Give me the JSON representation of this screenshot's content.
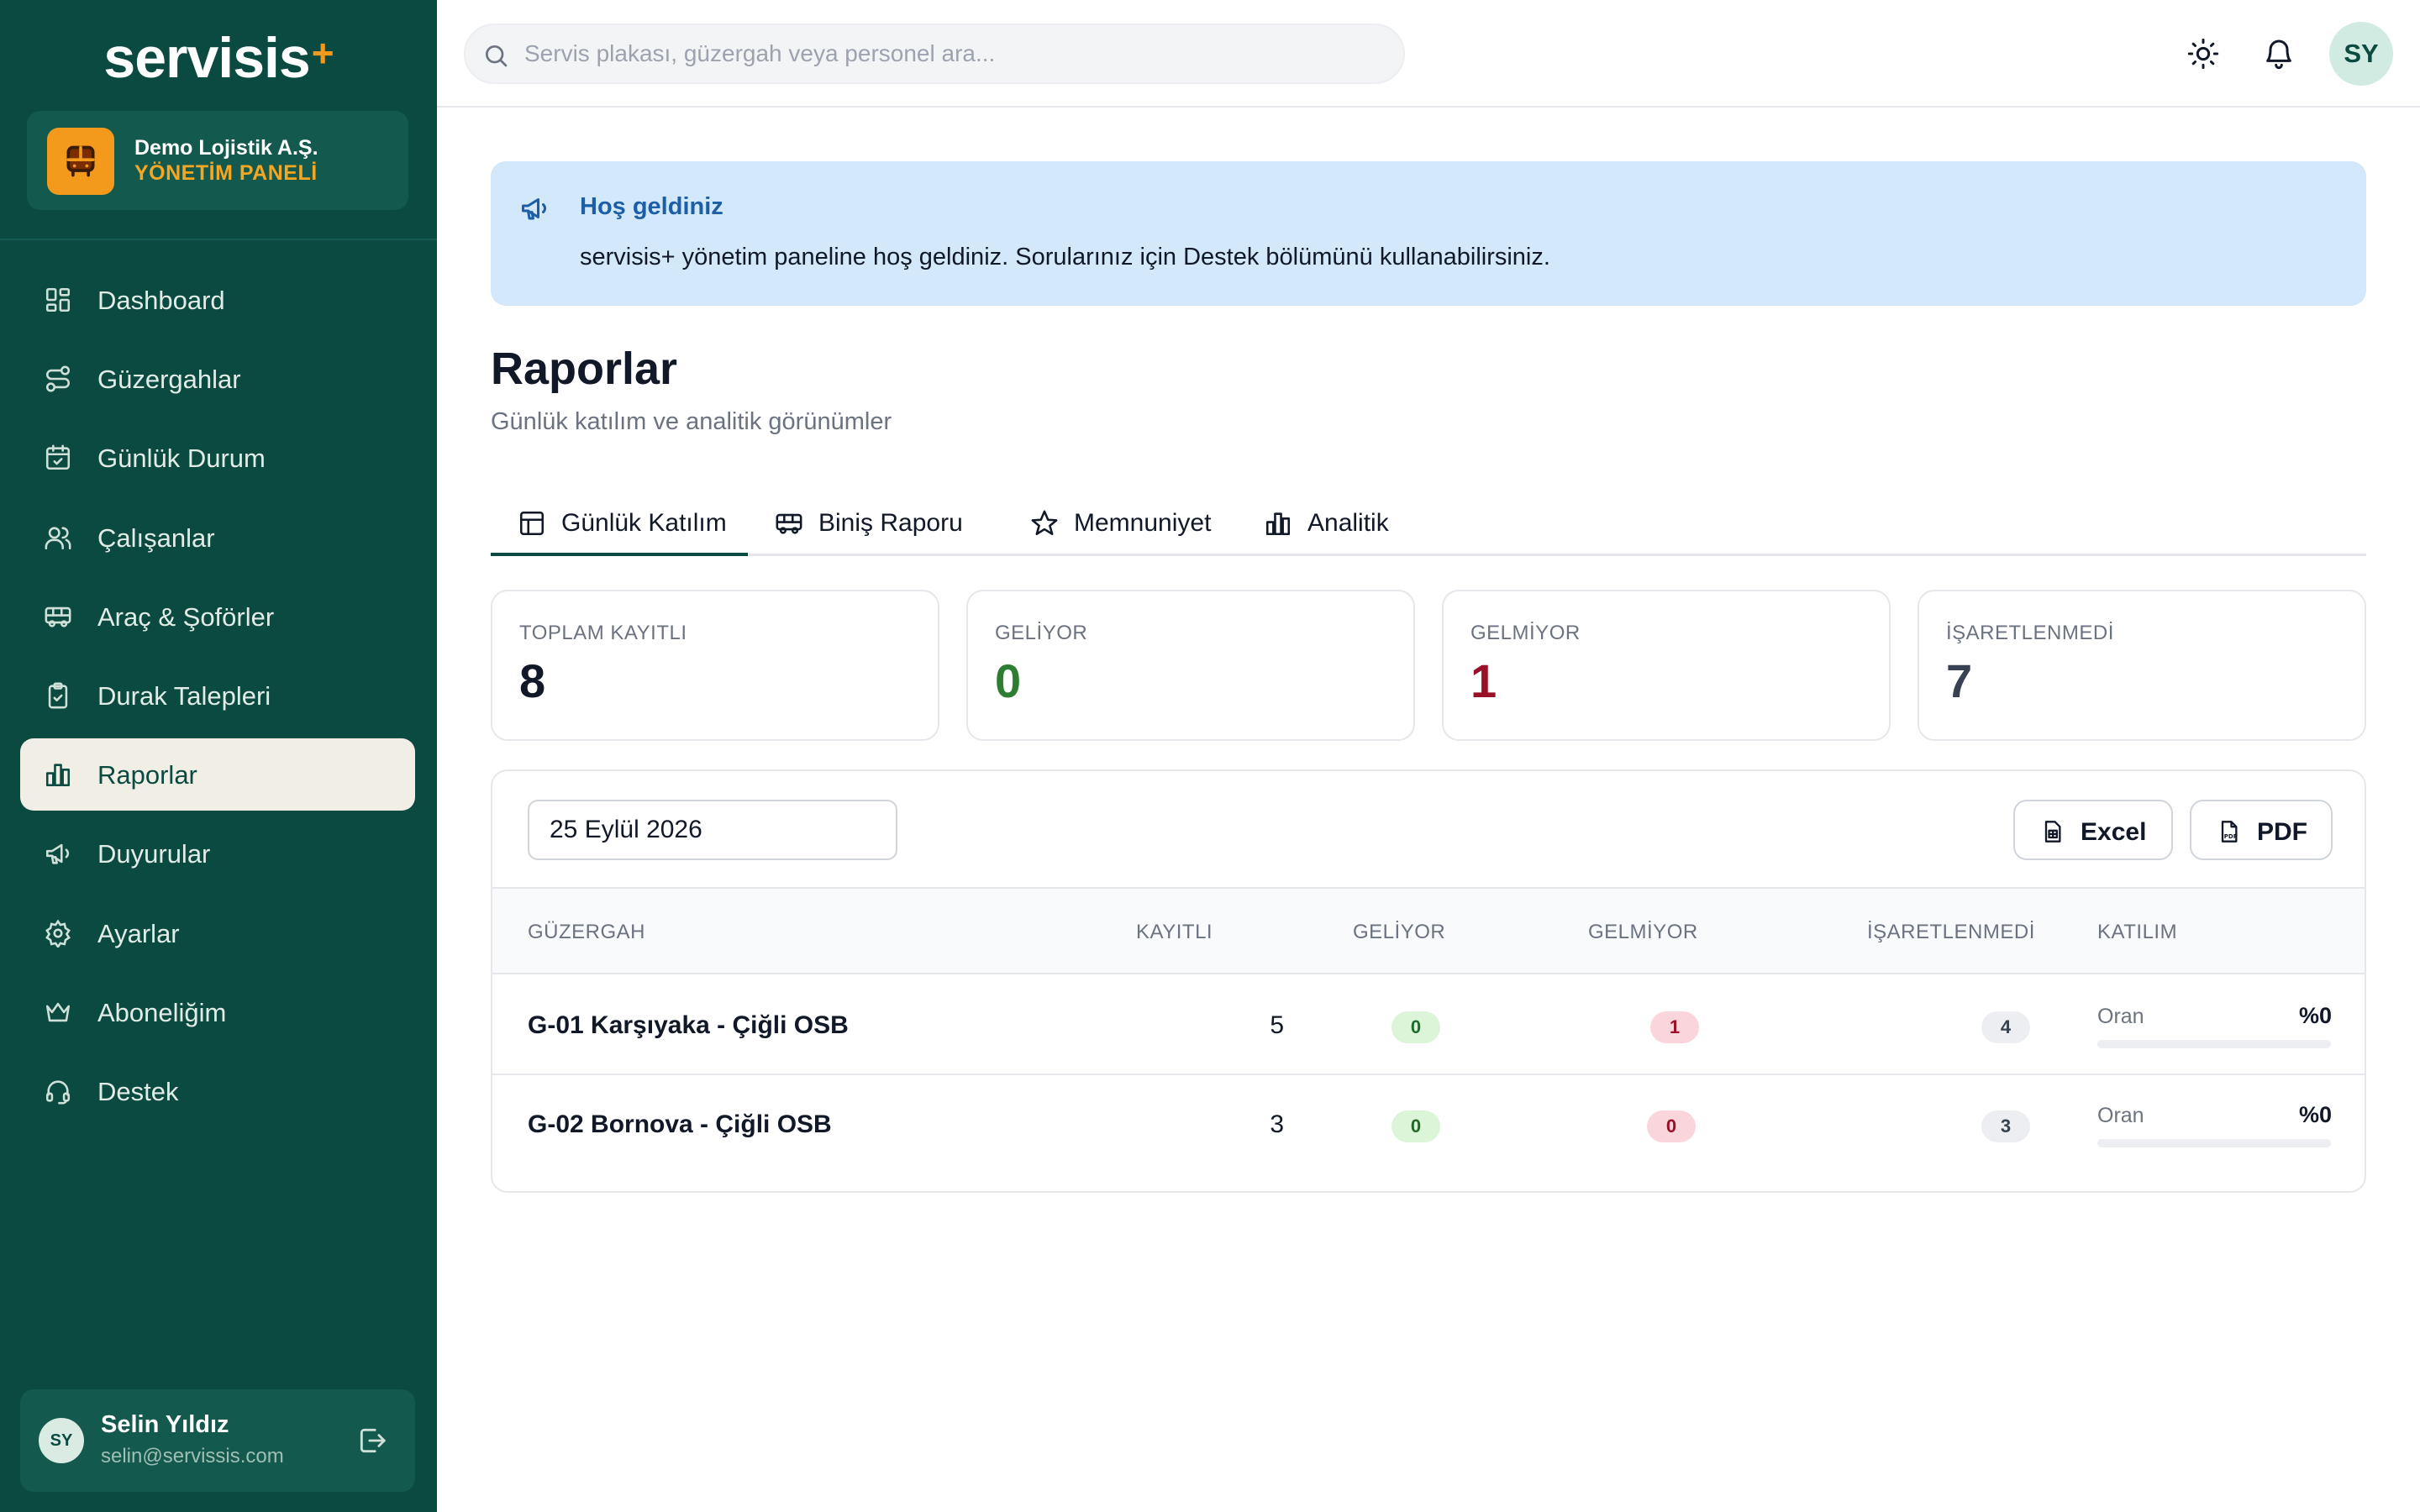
{
  "sidebar": {
    "logo_text": "servisis",
    "logo_plus": "+",
    "org": {
      "name": "Demo Lojistik A.Ş.",
      "role": "YÖNETİM PANELİ"
    },
    "items": [
      {
        "label": "Dashboard",
        "icon": "grid-icon"
      },
      {
        "label": "Güzergahlar",
        "icon": "route-icon"
      },
      {
        "label": "Günlük Durum",
        "icon": "calendar-check-icon"
      },
      {
        "label": "Çalışanlar",
        "icon": "users-icon"
      },
      {
        "label": "Araç & Şoförler",
        "icon": "bus-icon"
      },
      {
        "label": "Durak Talepleri",
        "icon": "clipboard-check-icon"
      },
      {
        "label": "Raporlar",
        "icon": "bar-chart-icon",
        "active": true
      },
      {
        "label": "Duyurular",
        "icon": "megaphone-icon"
      },
      {
        "label": "Ayarlar",
        "icon": "gear-icon"
      },
      {
        "label": "Aboneliğim",
        "icon": "crown-icon"
      },
      {
        "label": "Destek",
        "icon": "headset-icon"
      }
    ],
    "user": {
      "initials": "SY",
      "name": "Selin Yıldız",
      "email": "selin@servissis.com"
    }
  },
  "topbar": {
    "search_placeholder": "Servis plakası, güzergah veya personel ara...",
    "avatar_initials": "SY"
  },
  "banner": {
    "title": "Hoş geldiniz",
    "text": "servisis+ yönetim paneline hoş geldiniz. Sorularınız için Destek bölümünü kullanabilirsiniz."
  },
  "page": {
    "title": "Raporlar",
    "subtitle": "Günlük katılım ve analitik görünümler"
  },
  "tabs": [
    {
      "label": "Günlük Katılım",
      "icon": "table-icon",
      "active": true
    },
    {
      "label": "Biniş Raporu",
      "icon": "bus-icon"
    },
    {
      "label": "Memnuniyet",
      "icon": "star-icon"
    },
    {
      "label": "Analitik",
      "icon": "bar-chart-icon"
    }
  ],
  "stats": [
    {
      "label": "TOPLAM KAYITLI",
      "value": "8",
      "color": "#111827"
    },
    {
      "label": "GELİYOR",
      "value": "0",
      "color": "#2e7d32"
    },
    {
      "label": "GELMİYOR",
      "value": "1",
      "color": "#9b1029"
    },
    {
      "label": "İŞARETLENMEDİ",
      "value": "7",
      "color": "#374151"
    }
  ],
  "report": {
    "date_value": "25 Eylül 2026",
    "excel_label": "Excel",
    "pdf_label": "PDF",
    "columns": [
      "GÜZERGAH",
      "KAYITLI",
      "GELİYOR",
      "GELMİYOR",
      "İŞARETLENMEDİ",
      "KATILIM"
    ],
    "rows": [
      {
        "route": "G-01 Karşıyaka - Çiğli OSB",
        "registered": "5",
        "coming": "0",
        "not_coming": "1",
        "unmarked": "4",
        "rate_label": "Oran",
        "rate_value": "%0",
        "rate_fraction": 0
      },
      {
        "route": "G-02 Bornova - Çiğli OSB",
        "registered": "3",
        "coming": "0",
        "not_coming": "0",
        "unmarked": "3",
        "rate_label": "Oran",
        "rate_value": "%0",
        "rate_fraction": 0
      }
    ]
  },
  "colors": {
    "brand": "#0b4a40",
    "accent": "#f39a1c",
    "banner_bg": "#d3e9fb"
  }
}
